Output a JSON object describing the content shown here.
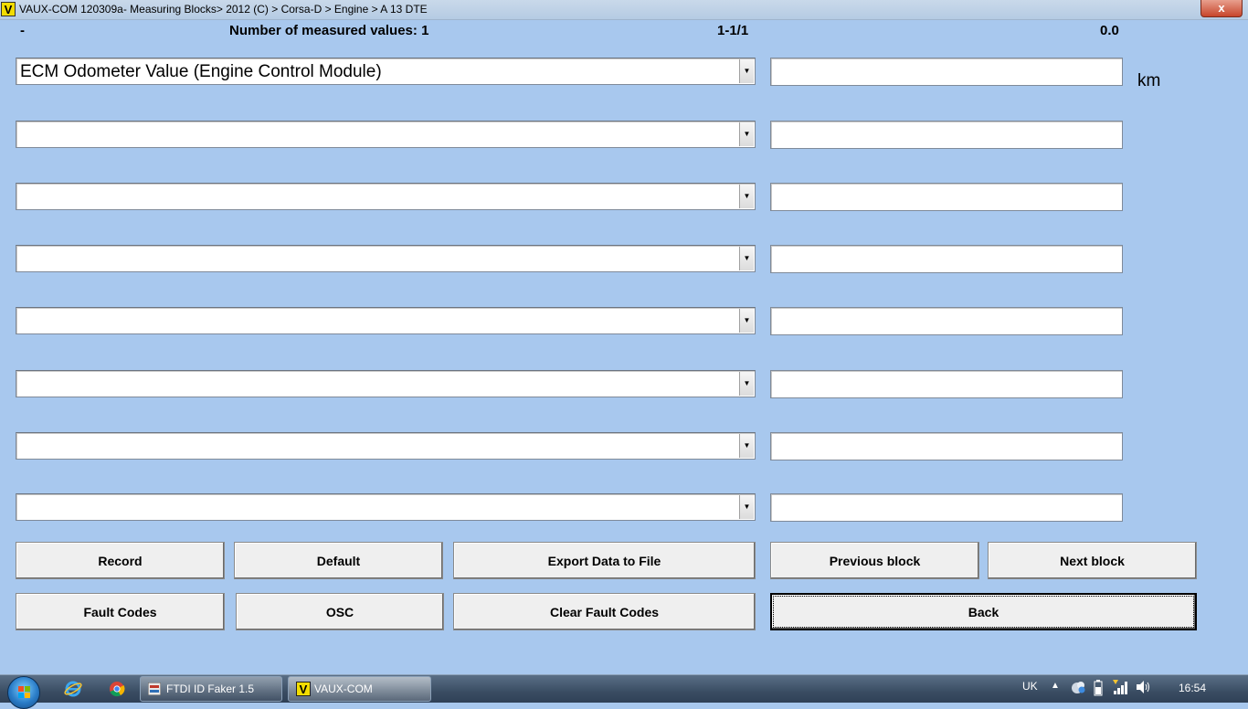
{
  "window": {
    "icon_letter": "V",
    "title": "VAUX-COM 120309a- Measuring Blocks> 2012 (C) > Corsa-D > Engine > A 13 DTE",
    "close_label": "x"
  },
  "status": {
    "dash": "-",
    "measured_label": "Number of measured values: 1",
    "page": "1-1/1",
    "value": "0.0"
  },
  "rows": [
    {
      "selected": "ECM Odometer Value (Engine Control Module)",
      "value": "",
      "unit": "km"
    },
    {
      "selected": "",
      "value": "",
      "unit": ""
    },
    {
      "selected": "",
      "value": "",
      "unit": ""
    },
    {
      "selected": "",
      "value": "",
      "unit": ""
    },
    {
      "selected": "",
      "value": "",
      "unit": ""
    },
    {
      "selected": "",
      "value": "",
      "unit": ""
    },
    {
      "selected": "",
      "value": "",
      "unit": ""
    },
    {
      "selected": "",
      "value": "",
      "unit": ""
    }
  ],
  "dropdown_arrow": "▼",
  "buttons": {
    "record": "Record",
    "default": "Default",
    "export": "Export Data to File",
    "previous_block": "Previous block",
    "next_block": "Next block",
    "fault_codes": "Fault Codes",
    "osc": "OSC",
    "clear_fault_codes": "Clear Fault Codes",
    "back": "Back"
  },
  "taskbar": {
    "items": [
      {
        "label": "FTDI ID Faker 1.5",
        "icon": "ftdi-app-icon"
      },
      {
        "label": "VAUX-COM",
        "icon": "vaux-com-app-icon",
        "icon_letter": "V"
      }
    ],
    "language": "UK",
    "clock": "16:54"
  }
}
